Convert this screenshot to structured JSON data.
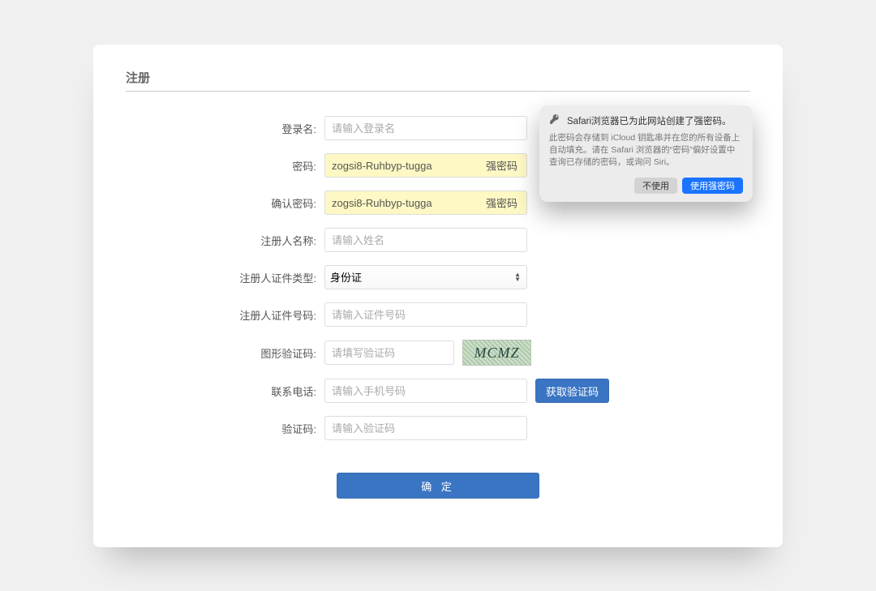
{
  "title": "注册",
  "fields": {
    "login": {
      "label": "登录名:",
      "placeholder": "请输入登录名"
    },
    "password": {
      "label": "密码:",
      "value": "zogsi8-Ruhbyp-tugga",
      "strong": "强密码"
    },
    "confirm": {
      "label": "确认密码:",
      "value": "zogsi8-Ruhbyp-tugga",
      "strong": "强密码"
    },
    "name": {
      "label": "注册人名称:",
      "placeholder": "请输入姓名"
    },
    "idtype": {
      "label": "注册人证件类型:",
      "value": "身份证"
    },
    "idnum": {
      "label": "注册人证件号码:",
      "placeholder": "请输入证件号码"
    },
    "captcha": {
      "label": "图形验证码:",
      "placeholder": "请填写验证码",
      "image_text": "MCMZ"
    },
    "phone": {
      "label": "联系电话:",
      "placeholder": "请输入手机号码",
      "button": "获取验证码"
    },
    "smscode": {
      "label": "验证码:",
      "placeholder": "请输入验证码"
    }
  },
  "submit": "确 定",
  "popover": {
    "title": "Safari浏览器已为此网站创建了强密码。",
    "body": "此密码会存储到 iCloud 钥匙串并在您的所有设备上自动填充。请在 Safari 浏览器的“密码”偏好设置中查询已存储的密码，或询问 Siri。",
    "cancel": "不使用",
    "ok": "使用强密码"
  }
}
